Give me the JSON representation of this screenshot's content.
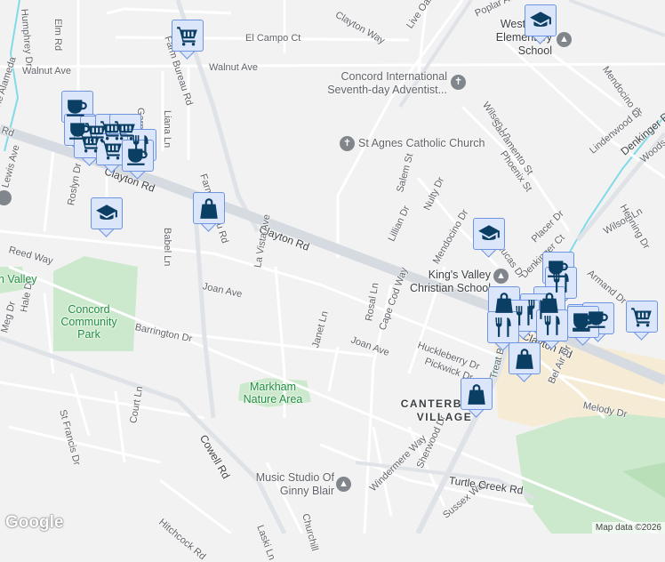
{
  "map": {
    "roads": {
      "clayton_rd_1": "Clayton Rd",
      "clayton_rd_2": "Clayton Rd",
      "clayton_rd_3": "Clayton Rd",
      "clayton_rd_left": "Rd",
      "farm_bureau_top": "Farm Bureau Rd",
      "farm_bureau": "Farm Bureau Rd",
      "el_campo": "El Campo Ct",
      "walnut_ave_1": "Walnut Ave",
      "walnut_ave_2": "Walnut Ave",
      "elm_rd": "Elm Rd",
      "humphrey": "Humphrey Dr",
      "alameda": "The Alameda",
      "garnet": "Garnet Ln",
      "liana": "Liana Ln",
      "lewis": "Lewis Ave",
      "roslyn": "Roslyn Dr",
      "babel": "Babel Ln",
      "reed": "Reed Way",
      "joan_1": "Joan Ave",
      "joan_2": "Joan Ave",
      "la_vista": "La Vista Ave",
      "barrington": "Barrington Dr",
      "hale": "Hale Dr",
      "meg": "Meg Dr",
      "st_francis": "St Francis Dr",
      "court": "Court Ln",
      "cowell": "Cowell Rd",
      "hitchcock": "Hitchcock Rd",
      "laski": "Laski Ln",
      "churchill": "Churchill",
      "janet": "Janet Ln",
      "rosal": "Rosal Ln",
      "cape_cod": "Cape Cod Way",
      "huckleberry": "Huckleberry Dr",
      "pickwick": "Pickwick Dr",
      "treat": "Treat Blvd",
      "bel_air": "Bel Air Dr",
      "melody": "Melody Dr",
      "sherwood": "Sherwood Dr",
      "windermere": "Windermere Way",
      "sussex": "Sussex Way",
      "turtle_creek": "Turtle Creek Rd",
      "clayton_way": "Clayton Way",
      "live_oak": "Live Oak Ave",
      "poplar": "Poplar Ave",
      "wilson_1": "Wilson Ln",
      "wilson_2": "Wilson Ln",
      "sacramento": "Sacramento St",
      "phoenix": "Phoenix St",
      "mendocino_1": "Mendocino Dr",
      "mendocino_2": "Mendocino Dr",
      "lindenwood": "Lindenwood Dr",
      "denkinger": "Denkinger Rd",
      "denkinger_ct": "Denkinger Ct",
      "woods": "Woods",
      "henning": "Henning Dr",
      "salem": "Salem St",
      "nulty": "Nulty Dr",
      "lillian": "Lillian Dr",
      "placer": "Placer Dr",
      "lucas": "Lucas Dr",
      "armand": "Armand Dr"
    },
    "places": {
      "westwood": "Westwood Elementary School",
      "concord_intl": "Concord International Seventh-day Adventist...",
      "st_agnes": "St Agnes Catholic Church",
      "kings_valley": "King's Valley Christian School",
      "music_studio": "Music Studio Of Ginny Blair",
      "concord_park": "Concord Community Park",
      "markham": "Markham Nature Area",
      "valley": "n Valley",
      "canterbury": "CANTERBURY VILLAGE"
    },
    "markers": [
      {
        "icon": "shopping-cart"
      },
      {
        "icon": "coffee-cup"
      },
      {
        "icon": "coffee-cup"
      },
      {
        "icon": "shopping-cart"
      },
      {
        "icon": "shopping-cart"
      },
      {
        "icon": "shopping-cart"
      },
      {
        "icon": "shopping-cart"
      },
      {
        "icon": "fork-knife"
      },
      {
        "icon": "shopping-cart"
      },
      {
        "icon": "coffee-cup"
      },
      {
        "icon": "graduation-cap"
      },
      {
        "icon": "shopping-bag"
      },
      {
        "icon": "graduation-cap"
      },
      {
        "icon": "graduation-cap"
      },
      {
        "icon": "coffee-cup"
      },
      {
        "icon": "fork-knife"
      },
      {
        "icon": "shopping-bag"
      },
      {
        "icon": "shopping-bag"
      },
      {
        "icon": "fork-knife"
      },
      {
        "icon": "coffee-cup"
      },
      {
        "icon": "fork-knife"
      },
      {
        "icon": "fork-knife"
      },
      {
        "icon": "fork-knife"
      },
      {
        "icon": "coffee-cup"
      },
      {
        "icon": "coffee-cup"
      },
      {
        "icon": "shopping-cart"
      },
      {
        "icon": "shopping-bag"
      },
      {
        "icon": "shopping-bag"
      }
    ],
    "logo": "Google",
    "attribution": "Map data ©2026"
  }
}
